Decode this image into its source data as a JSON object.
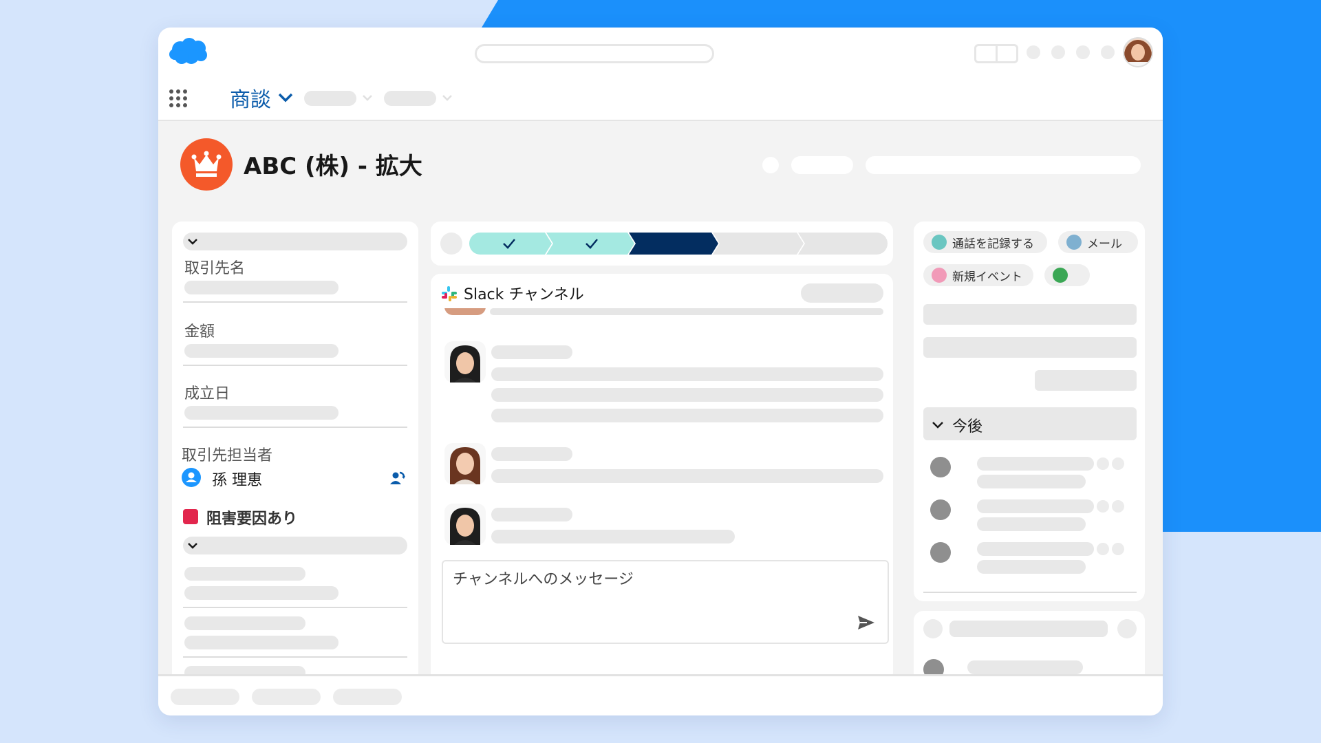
{
  "nav": {
    "object_tab": "商談"
  },
  "record": {
    "title": "ABC (株) - 拡大"
  },
  "details": {
    "field_account": "取引先名",
    "field_amount": "金額",
    "field_close_date": "成立日",
    "field_contact": "取引先担当者",
    "contact_name": "孫 理恵",
    "blocker": "阻害要因あり"
  },
  "slack": {
    "title": "Slack チャンネル",
    "composer_placeholder": "チャンネルへのメッセージ"
  },
  "activity": {
    "log_call": "通話を記録する",
    "email": "メール",
    "new_event": "新規イベント",
    "upcoming": "今後"
  },
  "colors": {
    "brand_blue": "#1b96ff",
    "accent_orange": "#f4592a",
    "path_done": "#a4e9e1",
    "path_current": "#032d60",
    "blocker_red": "#e2264d",
    "chip_call": "#6ac6c1",
    "chip_email": "#7fb0d0",
    "chip_event": "#f19ab8",
    "chip_green": "#3ba755"
  }
}
